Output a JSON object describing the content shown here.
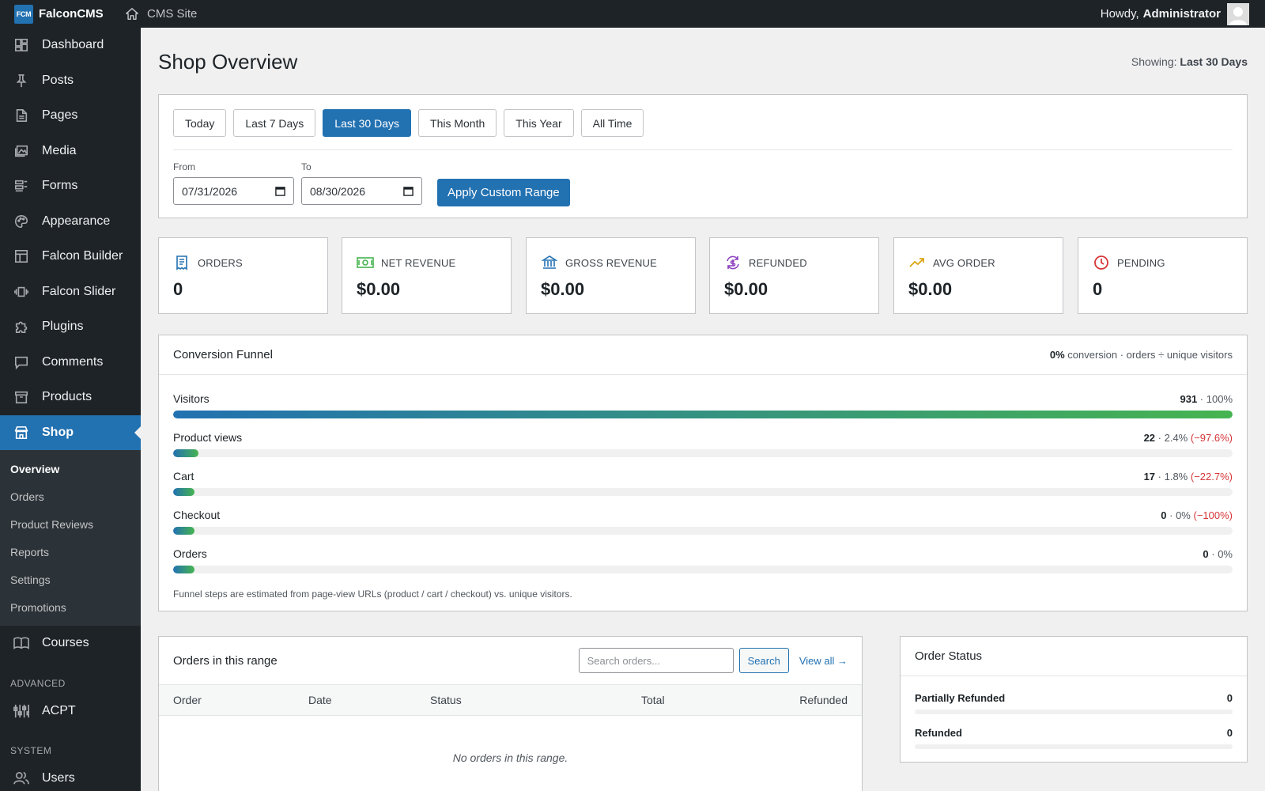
{
  "topbar": {
    "logo_text": "FCM",
    "brand": "FalconCMS",
    "site_label": "CMS Site",
    "greeting": "Howdy,",
    "username": "Administrator"
  },
  "sidebar": {
    "items": [
      {
        "label": "Dashboard",
        "icon": "dashboard-icon"
      },
      {
        "label": "Posts",
        "icon": "pin-icon"
      },
      {
        "label": "Pages",
        "icon": "page-icon"
      },
      {
        "label": "Media",
        "icon": "media-icon"
      },
      {
        "label": "Forms",
        "icon": "forms-icon"
      },
      {
        "label": "Appearance",
        "icon": "palette-icon"
      },
      {
        "label": "Falcon Builder",
        "icon": "builder-icon"
      },
      {
        "label": "Falcon Slider",
        "icon": "slider-icon"
      },
      {
        "label": "Plugins",
        "icon": "plugin-icon"
      },
      {
        "label": "Comments",
        "icon": "comment-icon"
      },
      {
        "label": "Products",
        "icon": "archive-icon"
      },
      {
        "label": "Shop",
        "icon": "store-icon"
      }
    ],
    "submenu": [
      "Overview",
      "Orders",
      "Product Reviews",
      "Reports",
      "Settings",
      "Promotions"
    ],
    "courses": "Courses",
    "section_advanced": "ADVANCED",
    "acpt": "ACPT",
    "section_system": "SYSTEM",
    "users": "Users"
  },
  "page": {
    "title": "Shop Overview",
    "showing_label": "Showing:",
    "showing_value": "Last 30 Days"
  },
  "range": {
    "buttons": [
      "Today",
      "Last 7 Days",
      "Last 30 Days",
      "This Month",
      "This Year",
      "All Time"
    ],
    "active": "Last 30 Days",
    "from_label": "From",
    "from_value": "07/31/2026",
    "to_label": "To",
    "to_value": "08/30/2026",
    "apply_label": "Apply Custom Range"
  },
  "stats": [
    {
      "label": "ORDERS",
      "value": "0",
      "icon": "receipt-icon",
      "color": "#2271b1"
    },
    {
      "label": "NET REVENUE",
      "value": "$0.00",
      "icon": "cash-icon",
      "color": "#46b450"
    },
    {
      "label": "GROSS REVENUE",
      "value": "$0.00",
      "icon": "bank-icon",
      "color": "#2271b1"
    },
    {
      "label": "REFUNDED",
      "value": "$0.00",
      "icon": "refund-icon",
      "color": "#8c3ec0"
    },
    {
      "label": "AVG ORDER",
      "value": "$0.00",
      "icon": "trend-icon",
      "color": "#dba617"
    },
    {
      "label": "PENDING",
      "value": "0",
      "icon": "clock-icon",
      "color": "#d63638"
    }
  ],
  "funnel": {
    "title": "Conversion Funnel",
    "conversion_value": "0%",
    "conversion_text": "conversion · orders ÷ unique visitors",
    "steps": [
      {
        "label": "Visitors",
        "count": "931",
        "pct": "100%",
        "delta": "",
        "fill": 1.0
      },
      {
        "label": "Product views",
        "count": "22",
        "pct": "2.4%",
        "delta": "(−97.6%)",
        "fill": 0.024
      },
      {
        "label": "Cart",
        "count": "17",
        "pct": "1.8%",
        "delta": "(−22.7%)",
        "fill": 0.018
      },
      {
        "label": "Checkout",
        "count": "0",
        "pct": "0%",
        "delta": "(−100%)",
        "fill": 0.0
      },
      {
        "label": "Orders",
        "count": "0",
        "pct": "0%",
        "delta": "",
        "fill": 0.0
      }
    ],
    "note": "Funnel steps are estimated from page-view URLs (product / cart / checkout) vs. unique visitors."
  },
  "orders": {
    "title": "Orders in this range",
    "search_placeholder": "Search orders...",
    "search_button": "Search",
    "view_all": "View all →",
    "columns": [
      "Order",
      "Date",
      "Status",
      "Total",
      "Refunded"
    ],
    "empty": "No orders in this range."
  },
  "order_status": {
    "title": "Order Status",
    "rows": [
      {
        "label": "Partially Refunded",
        "count": "0"
      },
      {
        "label": "Refunded",
        "count": "0"
      }
    ]
  }
}
